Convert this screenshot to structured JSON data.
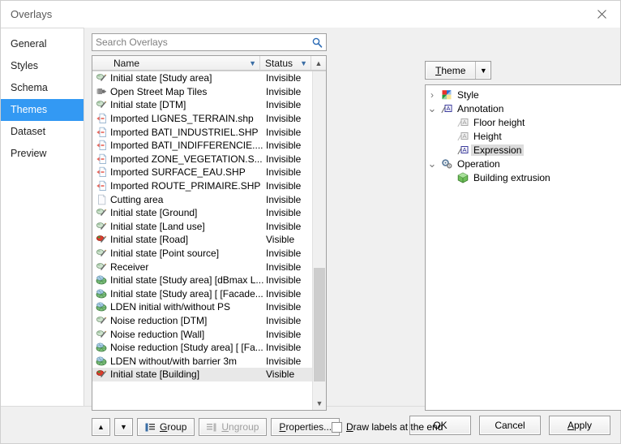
{
  "window": {
    "title": "Overlays",
    "close_label": "✕"
  },
  "sidebar": {
    "items": [
      {
        "label": "General",
        "selected": false
      },
      {
        "label": "Styles",
        "selected": false
      },
      {
        "label": "Schema",
        "selected": false
      },
      {
        "label": "Themes",
        "selected": true
      },
      {
        "label": "Dataset",
        "selected": false
      },
      {
        "label": "Preview",
        "selected": false
      }
    ],
    "selected_color": "#3399f3"
  },
  "search": {
    "placeholder": "Search Overlays",
    "value": "",
    "icon": "search-icon"
  },
  "list": {
    "columns": [
      {
        "label": "Name",
        "sort_icon": "chevron-down-icon"
      },
      {
        "label": "Status",
        "sort_icon": "chevron-down-icon"
      }
    ],
    "scroll_up_icon": "chevron-up-icon",
    "scroll_down_icon": "chevron-down-icon",
    "rows": [
      {
        "name": "Initial state [Study area]",
        "status": "Invisible",
        "icon": "layer-edit-icon",
        "selected": false
      },
      {
        "name": "Open Street Map Tiles",
        "status": "Invisible",
        "icon": "plugin-icon",
        "selected": false
      },
      {
        "name": "Initial state [DTM]",
        "status": "Invisible",
        "icon": "layer-edit-icon",
        "selected": false
      },
      {
        "name": "Imported LIGNES_TERRAIN.shp",
        "status": "Invisible",
        "icon": "import-file-icon",
        "selected": false
      },
      {
        "name": "Imported BATI_INDUSTRIEL.SHP",
        "status": "Invisible",
        "icon": "import-file-icon",
        "selected": false
      },
      {
        "name": "Imported BATI_INDIFFERENCIE....",
        "status": "Invisible",
        "icon": "import-file-icon",
        "selected": false
      },
      {
        "name": "Imported ZONE_VEGETATION.S...",
        "status": "Invisible",
        "icon": "import-file-icon",
        "selected": false
      },
      {
        "name": "Imported SURFACE_EAU.SHP",
        "status": "Invisible",
        "icon": "import-file-icon",
        "selected": false
      },
      {
        "name": "Imported ROUTE_PRIMAIRE.SHP",
        "status": "Invisible",
        "icon": "import-file-icon",
        "selected": false
      },
      {
        "name": "Cutting area",
        "status": "Invisible",
        "icon": "blank-page-icon",
        "selected": false
      },
      {
        "name": "Initial state [Ground]",
        "status": "Invisible",
        "icon": "layer-edit-icon",
        "selected": false
      },
      {
        "name": "Initial state [Land use]",
        "status": "Invisible",
        "icon": "layer-edit-icon",
        "selected": false
      },
      {
        "name": "Initial state [Road]",
        "status": "Visible",
        "icon": "layer-edit-red-icon",
        "selected": false
      },
      {
        "name": "Initial state [Point source]",
        "status": "Invisible",
        "icon": "layer-edit-icon",
        "selected": false
      },
      {
        "name": "Receiver",
        "status": "Invisible",
        "icon": "layer-edit-icon",
        "selected": false
      },
      {
        "name": "Initial state [Study area] [dBmax L...",
        "status": "Invisible",
        "icon": "grid-globe-icon",
        "selected": false
      },
      {
        "name": "Initial state [Study area] [ [Facade...",
        "status": "Invisible",
        "icon": "grid-globe-icon",
        "selected": false
      },
      {
        "name": "LDEN initial with/without PS",
        "status": "Invisible",
        "icon": "grid-globe-icon",
        "selected": false
      },
      {
        "name": "Noise reduction [DTM]",
        "status": "Invisible",
        "icon": "layer-edit-icon",
        "selected": false
      },
      {
        "name": "Noise reduction [Wall]",
        "status": "Invisible",
        "icon": "layer-edit-icon",
        "selected": false
      },
      {
        "name": "Noise reduction [Study area] [ [Fa...",
        "status": "Invisible",
        "icon": "grid-globe-icon",
        "selected": false
      },
      {
        "name": "LDEN without/with barrier 3m",
        "status": "Invisible",
        "icon": "grid-globe-icon",
        "selected": false
      },
      {
        "name": "Initial state [Building]",
        "status": "Visible",
        "icon": "layer-edit-red-icon",
        "selected": true
      }
    ]
  },
  "toolbar": {
    "move_up_label": "▲",
    "move_down_label": "▼",
    "group_label": "Group",
    "group_accesskey": "G",
    "ungroup_label": "Ungroup",
    "ungroup_accesskey": "U",
    "ungroup_disabled": true,
    "properties_label": "Properties...",
    "properties_accesskey": "P",
    "draw_labels_label": "Draw labels at the end",
    "draw_labels_accesskey": "D",
    "draw_labels_checked": false
  },
  "theme_panel": {
    "button_label": "Theme",
    "button_accesskey": "T",
    "button_arrow": "▼",
    "move_up_label": "▲",
    "move_down_label": "▼",
    "tree": [
      {
        "label": "Style",
        "depth": 1,
        "expander": "collapsed",
        "icon": "style-swatch-icon",
        "selected": false
      },
      {
        "label": "Annotation",
        "depth": 1,
        "expander": "expanded",
        "icon": "annotation-icon",
        "selected": false
      },
      {
        "label": "Floor height",
        "depth": 2,
        "expander": "none",
        "icon": "annotation-grey-icon",
        "selected": false
      },
      {
        "label": "Height",
        "depth": 2,
        "expander": "none",
        "icon": "annotation-grey-icon",
        "selected": false
      },
      {
        "label": "Expression",
        "depth": 2,
        "expander": "none",
        "icon": "annotation-icon",
        "selected": true
      },
      {
        "label": "Operation",
        "depth": 1,
        "expander": "expanded",
        "icon": "gears-icon",
        "selected": false
      },
      {
        "label": "Building extrusion",
        "depth": 2,
        "expander": "none",
        "icon": "extrusion-icon",
        "selected": false
      }
    ]
  },
  "footer": {
    "ok_label": "OK",
    "cancel_label": "Cancel",
    "apply_label": "Apply",
    "apply_accesskey": "A"
  }
}
